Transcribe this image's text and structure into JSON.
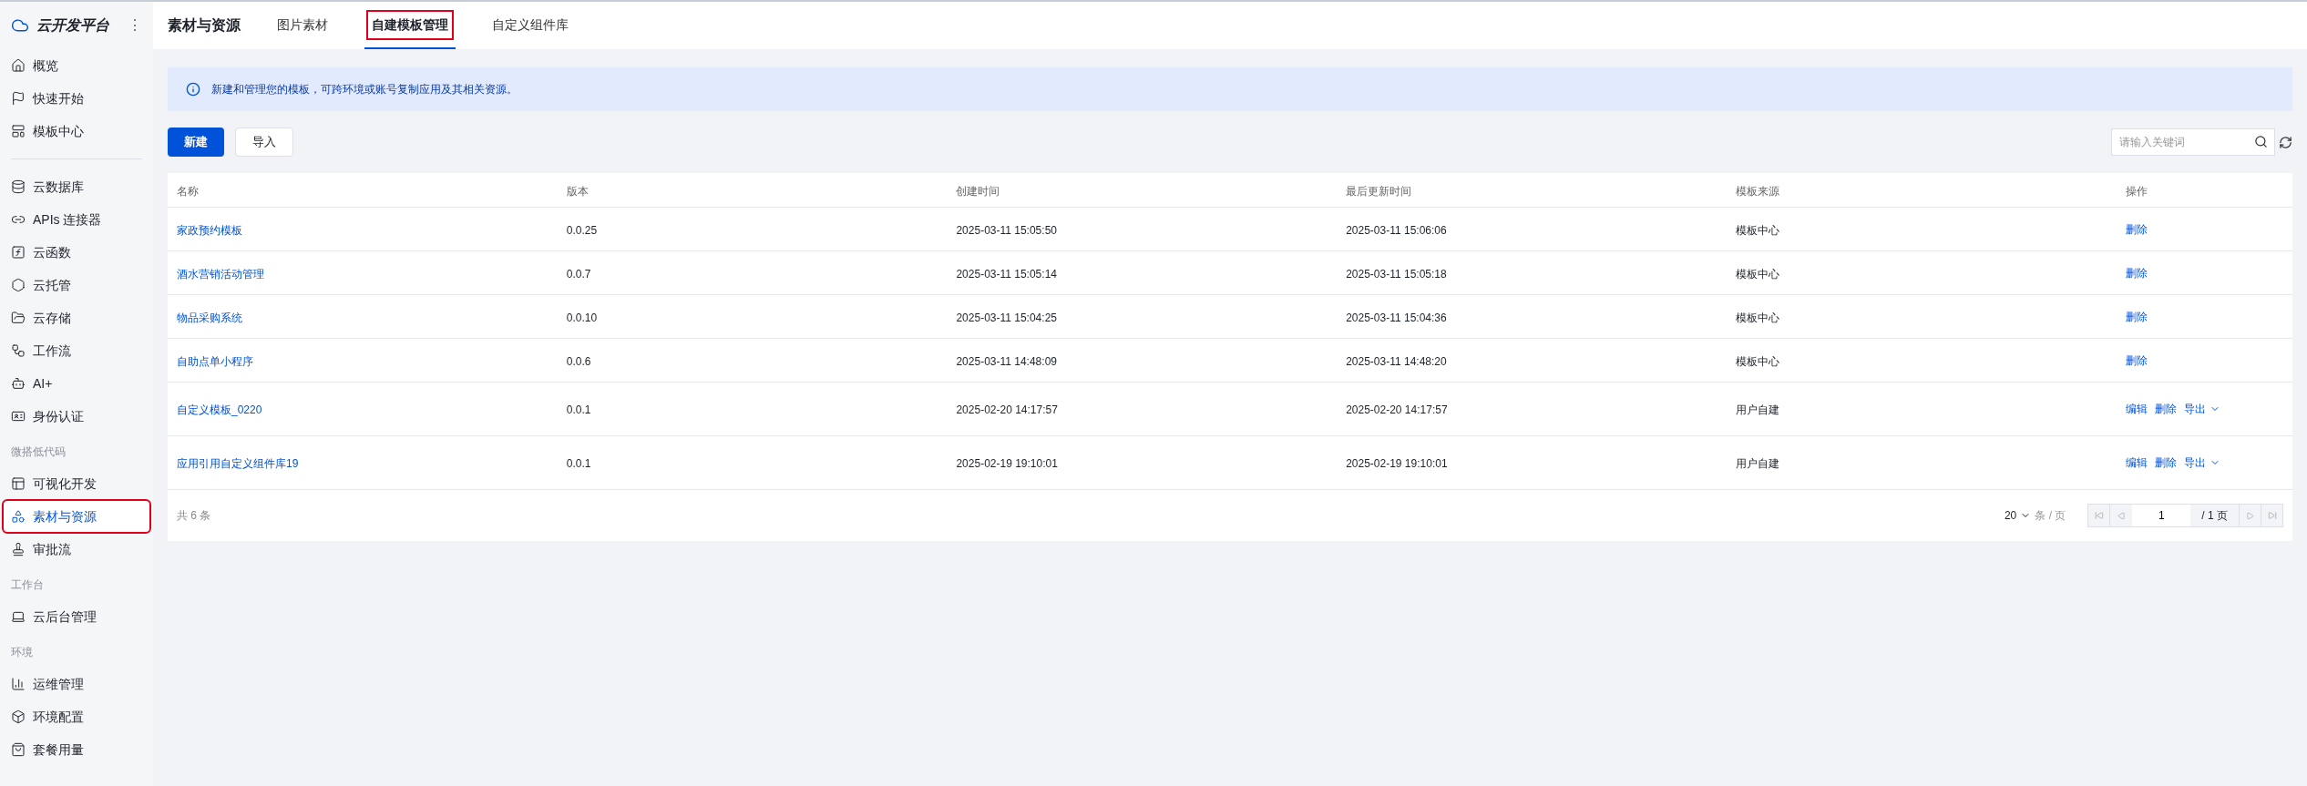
{
  "sidebar": {
    "brand": "云开发平台",
    "more": "⋮",
    "items": [
      {
        "kind": "item",
        "label": "概览",
        "selected": false,
        "annotated": false
      },
      {
        "kind": "item",
        "label": "快速开始",
        "selected": false,
        "annotated": false
      },
      {
        "kind": "item",
        "label": "模板中心",
        "selected": false,
        "annotated": false
      },
      {
        "kind": "divider"
      },
      {
        "kind": "item",
        "label": "云数据库",
        "selected": false,
        "annotated": false
      },
      {
        "kind": "item",
        "label": "APIs 连接器",
        "selected": false,
        "annotated": false
      },
      {
        "kind": "item",
        "label": "云函数",
        "selected": false,
        "annotated": false
      },
      {
        "kind": "item",
        "label": "云托管",
        "selected": false,
        "annotated": false
      },
      {
        "kind": "item",
        "label": "云存储",
        "selected": false,
        "annotated": false
      },
      {
        "kind": "item",
        "label": "工作流",
        "selected": false,
        "annotated": false
      },
      {
        "kind": "item",
        "label": "AI+",
        "selected": false,
        "annotated": false
      },
      {
        "kind": "item",
        "label": "身份认证",
        "selected": false,
        "annotated": false
      },
      {
        "kind": "section",
        "label": "微搭低代码"
      },
      {
        "kind": "item",
        "label": "可视化开发",
        "selected": false,
        "annotated": false
      },
      {
        "kind": "item",
        "label": "素材与资源",
        "selected": true,
        "annotated": true
      },
      {
        "kind": "item",
        "label": "审批流",
        "selected": false,
        "annotated": false
      },
      {
        "kind": "section",
        "label": "工作台"
      },
      {
        "kind": "item",
        "label": "云后台管理",
        "selected": false,
        "annotated": false
      },
      {
        "kind": "section",
        "label": "环境"
      },
      {
        "kind": "item",
        "label": "运维管理",
        "selected": false,
        "annotated": false
      },
      {
        "kind": "item",
        "label": "环境配置",
        "selected": false,
        "annotated": false
      },
      {
        "kind": "item",
        "label": "套餐用量",
        "selected": false,
        "annotated": false
      }
    ]
  },
  "header": {
    "title": "素材与资源",
    "tabs": [
      {
        "label": "图片素材",
        "selected": false,
        "annotated": false
      },
      {
        "label": "自建模板管理",
        "selected": true,
        "annotated": true
      },
      {
        "label": "自定义组件库",
        "selected": false,
        "annotated": false
      }
    ]
  },
  "notice": "新建和管理您的模板，可跨环境或账号复制应用及其相关资源。",
  "toolbar": {
    "buttons": [
      {
        "label": "新建",
        "kind": "primary"
      },
      {
        "label": "导入",
        "kind": "default"
      }
    ],
    "search": {
      "placeholder": "请输入关键词"
    }
  },
  "table": {
    "columns": [
      "名称",
      "版本",
      "创建时间",
      "最后更新时间",
      "模板来源",
      "操作"
    ],
    "rows": [
      {
        "name": "家政预约模板",
        "version": "0.0.25",
        "created": "2025-03-11 15:05:50",
        "updated": "2025-03-11 15:06:06",
        "source": "模板中心",
        "actions": [
          {
            "label": "删除",
            "kind": "link"
          }
        ]
      },
      {
        "name": "酒水营销活动管理",
        "version": "0.0.7",
        "created": "2025-03-11 15:05:14",
        "updated": "2025-03-11 15:05:18",
        "source": "模板中心",
        "actions": [
          {
            "label": "删除",
            "kind": "link"
          }
        ]
      },
      {
        "name": "物品采购系统",
        "version": "0.0.10",
        "created": "2025-03-11 15:04:25",
        "updated": "2025-03-11 15:04:36",
        "source": "模板中心",
        "actions": [
          {
            "label": "删除",
            "kind": "link"
          }
        ]
      },
      {
        "name": "自助点单小程序",
        "version": "0.0.6",
        "created": "2025-03-11 14:48:09",
        "updated": "2025-03-11 14:48:20",
        "source": "模板中心",
        "actions": [
          {
            "label": "删除",
            "kind": "link"
          }
        ]
      },
      {
        "name": "自定义模板_0220",
        "version": "0.0.1",
        "created": "2025-02-20 14:17:57",
        "updated": "2025-02-20 14:17:57",
        "source": "用户自建",
        "actions": [
          {
            "label": "编辑",
            "kind": "link"
          },
          {
            "label": "删除",
            "kind": "link"
          },
          {
            "label": "导出",
            "kind": "dropdown"
          }
        ]
      },
      {
        "name": "应用引用自定义组件库19",
        "version": "0.0.1",
        "created": "2025-02-19 19:10:01",
        "updated": "2025-02-19 19:10:01",
        "source": "用户自建",
        "actions": [
          {
            "label": "编辑",
            "kind": "link"
          },
          {
            "label": "删除",
            "kind": "link"
          },
          {
            "label": "导出",
            "kind": "dropdown"
          }
        ]
      }
    ]
  },
  "pagination": {
    "total": "共 6 条",
    "page_size": "20",
    "page_size_unit": "条 / 页",
    "page": "1",
    "page_total": "/ 1 页"
  }
}
